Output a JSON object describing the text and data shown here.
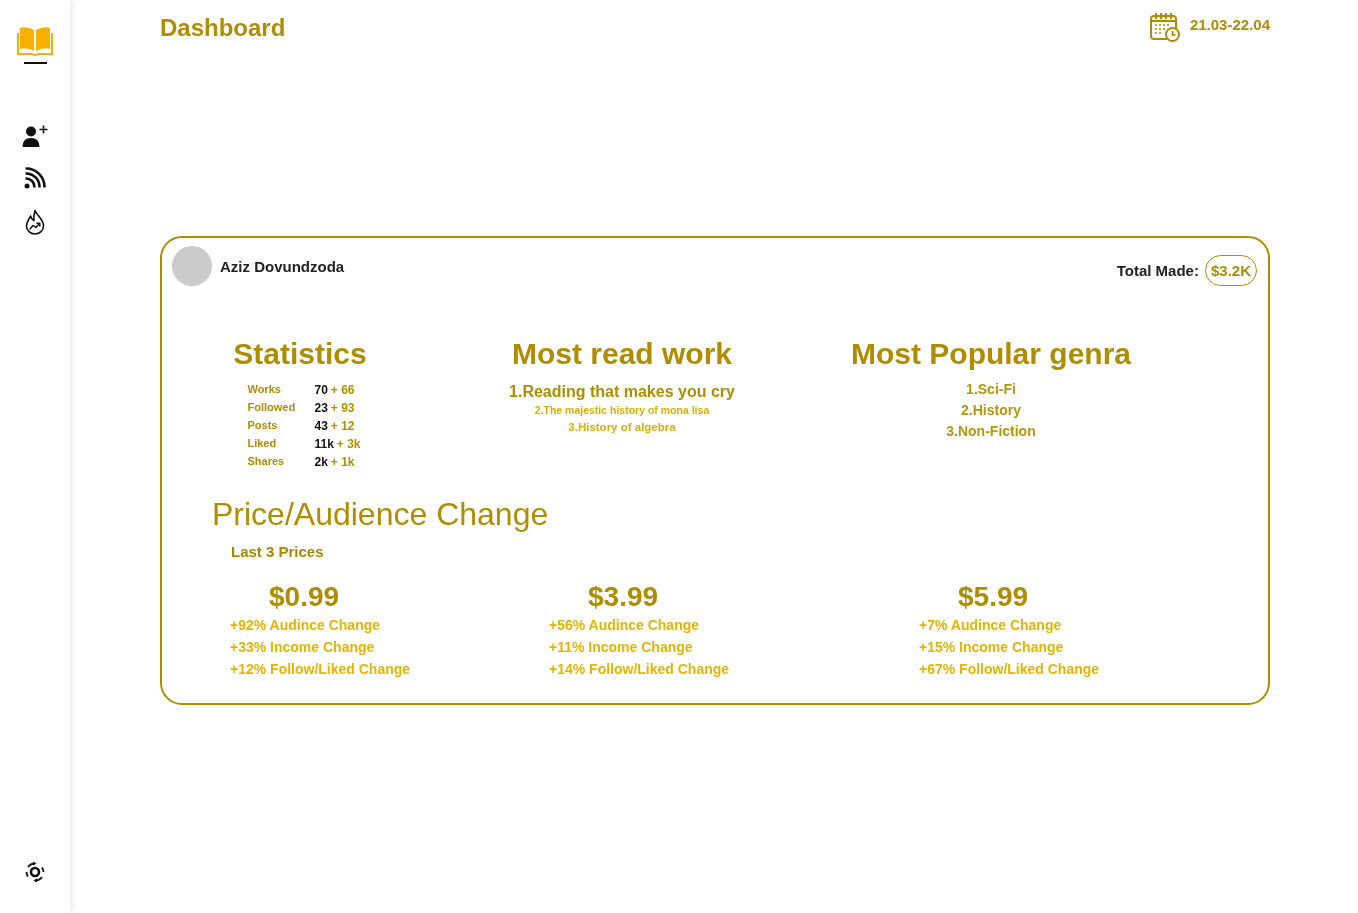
{
  "header": {
    "title": "Dashboard",
    "date_range": "21.03-22.04"
  },
  "author_card": {
    "author": "Aziz Dovundzoda",
    "total_label": "Total Made:",
    "total_value": "$3.2K",
    "statistics": {
      "title": "Statistics",
      "rows": [
        {
          "label": "Works",
          "value": "70",
          "change": "+ 66"
        },
        {
          "label": "Followed",
          "value": "23",
          "change": "+ 93"
        },
        {
          "label": "Posts",
          "value": "43",
          "change": "+ 12"
        },
        {
          "label": "Liked",
          "value": "11k",
          "change": "+ 3k"
        },
        {
          "label": "Shares",
          "value": "2k",
          "change": "+ 1k"
        }
      ]
    },
    "most_read": {
      "title": "Most read work",
      "items": [
        "1.Reading that makes you cry",
        "2.The majestic history of mona lisa",
        "3.History of algebra"
      ]
    },
    "popular_genres": {
      "title": "Most Popular genra",
      "items": [
        "1.Sci-Fi",
        "2.History",
        "3.Non-Fiction"
      ]
    },
    "price_change": {
      "title": "Price/Audience Change",
      "subtitle": "Last 3 Prices",
      "prices": [
        {
          "price": "$0.99",
          "changes": [
            "+92% Audince Change",
            "+33% Income Change",
            "+12% Follow/Liked Change"
          ]
        },
        {
          "price": "$3.99",
          "changes": [
            "+56% Audince Change",
            "+11% Income Change",
            "+14% Follow/Liked Change"
          ]
        },
        {
          "price": "$5.99",
          "changes": [
            "+7% Audince Change",
            "+15% Income Change",
            "+67% Follow/Liked Change"
          ]
        }
      ]
    }
  }
}
